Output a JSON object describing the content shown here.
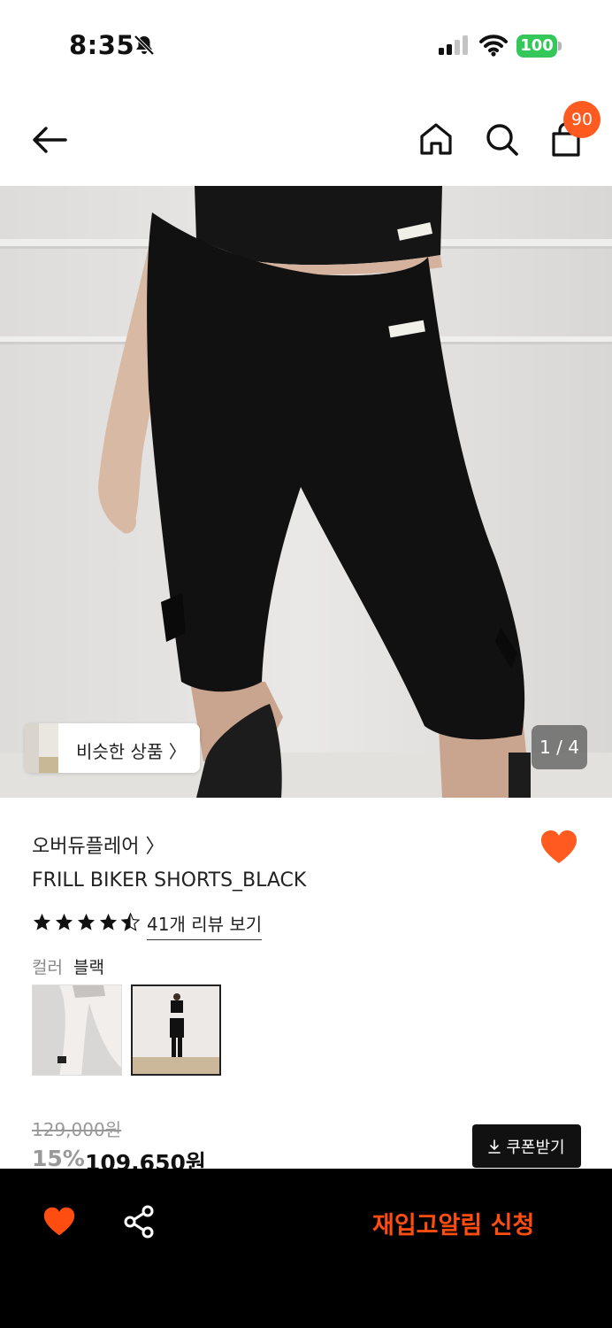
{
  "status_bar": {
    "time": "8:35",
    "battery": "100",
    "icons": [
      "bell-slash-icon",
      "signal-icon",
      "wifi-icon",
      "battery-icon"
    ]
  },
  "nav": {
    "icons": [
      "arrow-left-icon",
      "home-icon",
      "search-icon",
      "shopping-bag-icon"
    ],
    "cart_count": "90"
  },
  "hero": {
    "similar_label": "비슷한 상품",
    "pager": "1 / 4"
  },
  "product": {
    "brand": "오버듀플레어",
    "name": "FRILL BIKER SHORTS_BLACK",
    "rating": 4.5,
    "reviews_link": "41개 리뷰 보기",
    "color_label": "컬러",
    "color_value": "블랙",
    "original_price": "129,000원",
    "discount": "15%",
    "sale_price": "109,650원",
    "coupon_label": "쿠폰받기"
  },
  "bottom_bar": {
    "restock_label": "재입고알림 신청"
  },
  "colors": {
    "accent": "#ff5a1f",
    "cta": "#ff4d12",
    "battery": "#34c759"
  }
}
